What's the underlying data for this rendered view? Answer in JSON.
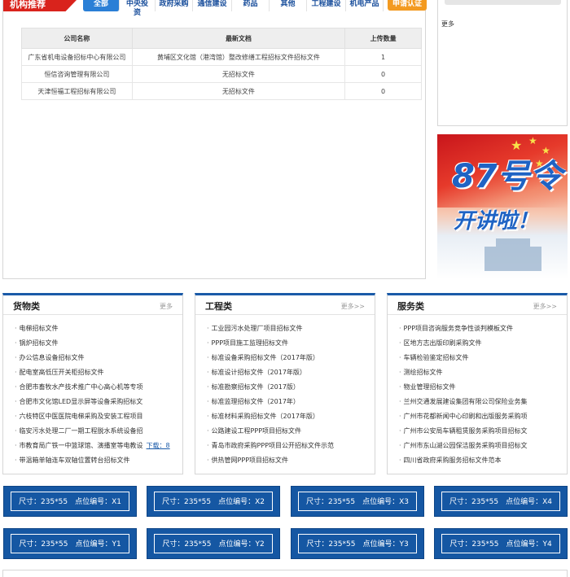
{
  "org_section": {
    "title": "机构推荐",
    "tabs": [
      "全部",
      "中央投资",
      "政府采购",
      "通信建设",
      "药品",
      "其他",
      "工程建设",
      "机电产品"
    ],
    "fav_label": "申请认证",
    "table": {
      "headers": [
        "公司名称",
        "最新文档",
        "上传数量"
      ],
      "rows": [
        [
          "广东省机电设备招标中心有限公司",
          "黄埔区文化馆（港湾馆）整改修缮工程招标文件招标文件",
          "1"
        ],
        [
          "恒信咨询管理有限公司",
          "无招标文件",
          "0"
        ],
        [
          "天津恒福工程招标有限公司",
          "无招标文件",
          "0"
        ]
      ]
    }
  },
  "right_box": {
    "more": "更多"
  },
  "banner": {
    "line1": "87号令",
    "line2": "开讲啦！"
  },
  "panels": [
    {
      "title": "货物类",
      "more": "更多",
      "items": [
        "电梯招标文件",
        "锅炉招标文件",
        "办公信息设备招标文件",
        "配电室高低压开关柜招标文件",
        "合肥市畜牧水产技术推广中心高心机等专项",
        "合肥市文化馆LED显示屏等设备采购招标文",
        "六枝特区中医医院电梯采购及安装工程项目",
        "临安污水处理二厂一期工程脱水系统设备招",
        "市教育局广铁一中篮球馆、演播室等电教设",
        "带温箱单轴连车双轴位置转台招标文件"
      ],
      "download_label": "下载：8"
    },
    {
      "title": "工程类",
      "more": "更多>>",
      "items": [
        "工业园污水处理厂项目招标文件",
        "PPP项目施工监理招标文件",
        "标准设备采购招标文件（2017年版）",
        "标准设计招标文件（2017年版）",
        "标准勘察招标文件（2017版）",
        "标准监理招标文件（2017年）",
        "标准材料采购招标文件（2017年版）",
        "公路建设工程PPP项目招标文件",
        "青岛市政府采购PPP项目公开招标文件示范",
        "供热管网PPP项目招标文件"
      ]
    },
    {
      "title": "服务类",
      "more": "更多>>",
      "items": [
        "PPP项目咨询服务竞争性谈判模板文件",
        "区地方志出版印刷采购文件",
        "车辆检验鉴定招标文件",
        "测绘招标文件",
        "物业管理招标文件",
        "兰州交通发展建设集团有限公司保险业务集",
        "广州市花都新闻中心印刷和出版服务采购项",
        "广州市公安局车辆租赁服务采购项目招标文",
        "广州市东山湖公园保洁服务采购项目招标文",
        "四川省政府采购服务招标文件范本"
      ]
    }
  ],
  "ads": [
    "尺寸：235*55　点位编号：X1",
    "尺寸：235*55　点位编号：X2",
    "尺寸：235*55　点位编号：X3",
    "尺寸：235*55　点位编号：X4",
    "尺寸：235*55　点位编号：Y1",
    "尺寸：235*55　点位编号：Y2",
    "尺寸：235*55　点位编号：Y3",
    "尺寸：235*55　点位编号：Y4"
  ],
  "colors": {
    "accent_red": "#d9231c",
    "tab_blue": "#2a7fd6",
    "panel_blue": "#1a5aa8",
    "ad_blue": "#1557a3",
    "fav_orange": "#f39a20"
  }
}
